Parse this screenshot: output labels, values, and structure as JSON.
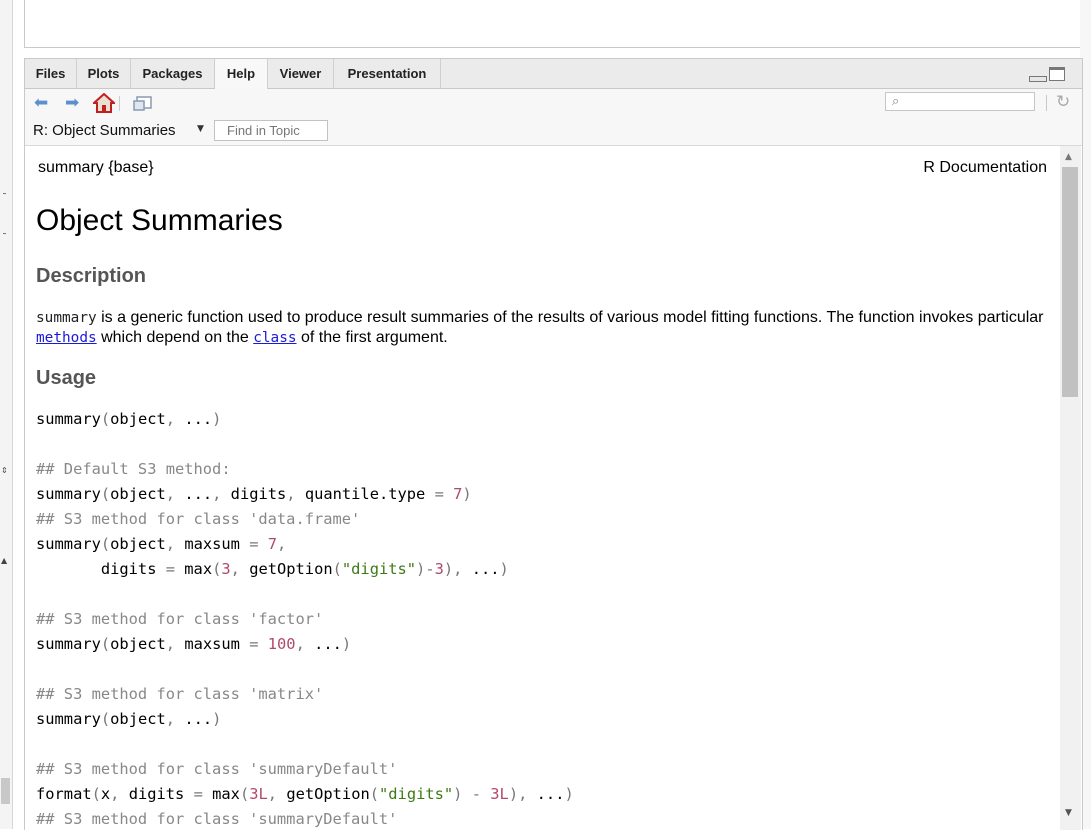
{
  "tabs": [
    {
      "label": "Files",
      "active": false
    },
    {
      "label": "Plots",
      "active": false
    },
    {
      "label": "Packages",
      "active": false
    },
    {
      "label": "Help",
      "active": true
    },
    {
      "label": "Viewer",
      "active": false
    },
    {
      "label": "Presentation",
      "active": false
    }
  ],
  "toolbar": {
    "back_icon": "back-arrow-icon",
    "forward_icon": "forward-arrow-icon",
    "home_icon": "home-icon",
    "popout_icon": "popout-window-icon",
    "search_placeholder": "",
    "refresh_icon": "refresh-icon"
  },
  "topic": {
    "title": "R: Object Summaries",
    "find_placeholder": "Find in Topic"
  },
  "doc": {
    "header_left": "summary {base}",
    "header_right": "R Documentation",
    "title": "Object Summaries",
    "description_heading": "Description",
    "description": {
      "code_summary": "summary",
      "text1": " is a generic function used to produce result summaries of the results of various model fitting functions. The function invokes particular ",
      "link_methods": "methods",
      "text2": " which depend on the ",
      "link_class": "class",
      "text3": " of the first argument."
    },
    "usage_heading": "Usage",
    "usage_lines": [
      "summary(object, ...)",
      "",
      "## Default S3 method:",
      "summary(object, ..., digits, quantile.type = 7)",
      "## S3 method for class 'data.frame'",
      "summary(object, maxsum = 7,",
      "       digits = max(3, getOption(\"digits\")-3), ...)",
      "",
      "## S3 method for class 'factor'",
      "summary(object, maxsum = 100, ...)",
      "",
      "## S3 method for class 'matrix'",
      "summary(object, ...)",
      "",
      "## S3 method for class 'summaryDefault'",
      "format(x, digits = max(3L, getOption(\"digits\") - 3L), ...)",
      "## S3 method for class 'summaryDefault'"
    ]
  },
  "colors": {
    "comment": "#888888",
    "number": "#b04a6b",
    "string": "#3d7a15",
    "link": "#1a1adc",
    "heading": "#555555"
  }
}
